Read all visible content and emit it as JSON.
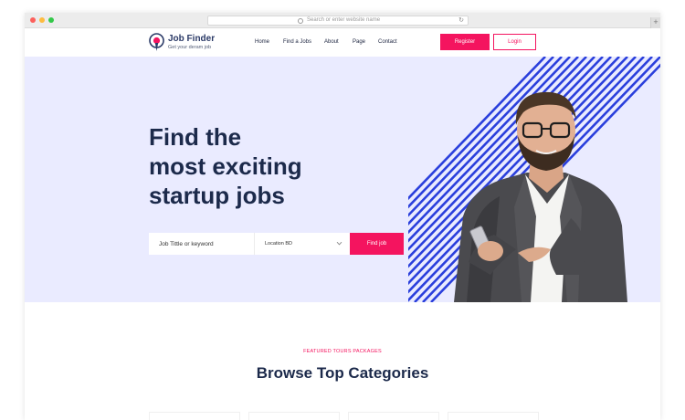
{
  "browser": {
    "url_placeholder": "Search or enter website name",
    "newtab_symbol": "+"
  },
  "navbar": {
    "logo_title": "Job Finder",
    "logo_subtitle": "Get your deram job",
    "nav_items": [
      "Home",
      "Find a Jobs",
      "About",
      "Page",
      "Contact"
    ],
    "register_label": "Register",
    "login_label": "Login"
  },
  "hero": {
    "title_lines": [
      "Find the",
      "most exciting",
      "startup jobs"
    ],
    "search_placeholder": "Job Tittle or keyword",
    "location_value": "Location BD",
    "find_button_label": "Find job"
  },
  "section": {
    "eyebrow": "FEATURED TOURS PACKAGES",
    "title": "Browse Top Categories"
  },
  "colors": {
    "accent": "#f4145f",
    "hero_bg": "#eaebff",
    "heading": "#1c2a4b",
    "stripes": "#2a3fdc"
  },
  "icons": {
    "logo": "location-pin-icon",
    "url_search": "search-icon",
    "url_reload": "reload-icon",
    "location_dropdown": "chevron-down-icon"
  }
}
